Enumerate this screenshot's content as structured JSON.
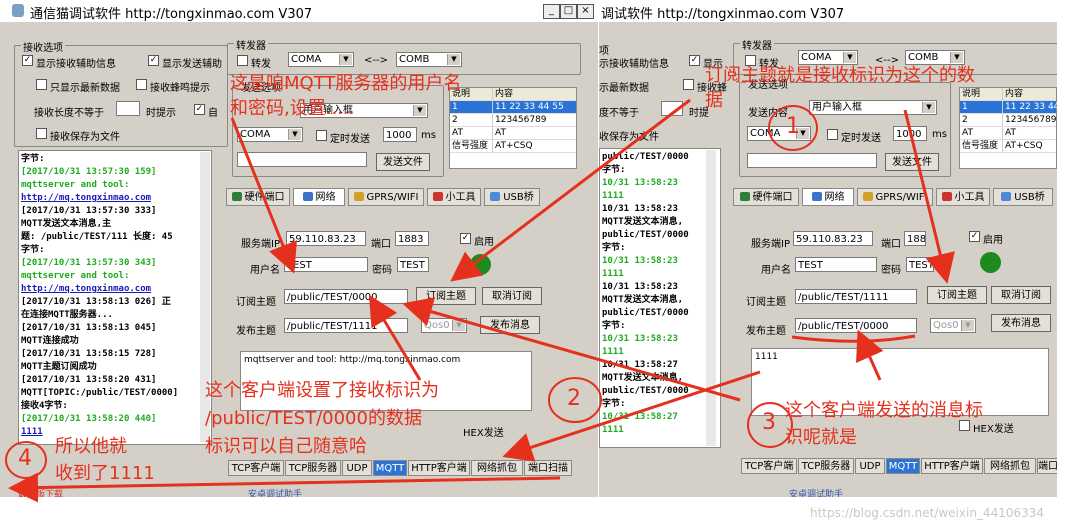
{
  "left": {
    "title": "通信猫调试软件 http://tongxinmao.com  V307",
    "win_buttons": [
      "_",
      "□",
      "×"
    ],
    "receive_group": "接收选项",
    "opt_show_recv_aux": "显示接收辅助信息",
    "opt_show_send_aux": "显示发送辅助",
    "opt_latest_only": "只显示最新数据",
    "opt_recv_beep": "接收蜂鸣提示",
    "len_label": "接收长度不等于",
    "len_suffix": "时提示",
    "opt_auto": "自",
    "opt_save_file": "接收保存为文件",
    "forward_group": "转发器",
    "forward_label": "转发",
    "com_a": "COMA",
    "arrow": "<-->",
    "com_b": "COMB",
    "send_group": "发送选项",
    "send_source": "用户输入框",
    "send_port": "COMA",
    "timed_send": "定时发送",
    "interval": "1000",
    "ms": "ms",
    "send_file_btn": "发送文件",
    "table_headers": [
      "说明",
      "内容"
    ],
    "table_rows": [
      [
        "1",
        "11 22 33 44 55"
      ],
      [
        "2",
        "123456789"
      ],
      [
        "AT",
        "AT"
      ],
      [
        "信号强度",
        "AT+CSQ"
      ]
    ],
    "tabs": [
      "硬件端口",
      "网络",
      "GPRS/WIFI",
      "小工具",
      "USB桥"
    ],
    "server_label": "服务端IP",
    "server_value": "59.110.83.23",
    "port_label": "端口",
    "port_value": "1883",
    "enable_label": "启用",
    "user_label": "用户名",
    "user_value": "TEST",
    "pwd_label": "密码",
    "pwd_value": "TEST",
    "sub_label": "订阅主题",
    "sub_value": "/public/TEST/0000",
    "sub_btn": "订阅主题",
    "unsub_btn": "取消订阅",
    "pub_label": "发布主题",
    "pub_value": "/public/TEST/1111",
    "qos": "Qos0",
    "pub_btn": "发布消息",
    "msg_text": "mqttserver and tool: http://mq.tongxinmao.com",
    "hex_send": "HEX发送",
    "bottom_tabs": [
      "TCP客户端",
      "TCP服务器",
      "UDP",
      "MQTT",
      "HTTP客户端",
      "网络抓包",
      "端口扫描"
    ],
    "status_left": "最新版下载",
    "status_mid": "安卓调试助手",
    "log_lines": [
      {
        "t": "字节:",
        "c": ""
      },
      {
        "t": "[2017/10/31 13:57:30 159]",
        "c": "green"
      },
      {
        "t": "mqttserver and tool:",
        "c": "green"
      },
      {
        "t": "http://mq.tongxinmao.com",
        "c": "blue"
      },
      {
        "t": "[2017/10/31 13:57:30 333]",
        "c": ""
      },
      {
        "t": "MQTT发送文本消息,主",
        "c": ""
      },
      {
        "t": "题: /public/TEST/111 长度: 45",
        "c": ""
      },
      {
        "t": "字节:",
        "c": ""
      },
      {
        "t": "[2017/10/31 13:57:30 343]",
        "c": "green"
      },
      {
        "t": "mqttserver and tool:",
        "c": "green"
      },
      {
        "t": "http://mq.tongxinmao.com",
        "c": "blue"
      },
      {
        "t": "[2017/10/31 13:58:13 026] 正",
        "c": ""
      },
      {
        "t": "在连接MQTT服务器...",
        "c": ""
      },
      {
        "t": "[2017/10/31 13:58:13 045]",
        "c": ""
      },
      {
        "t": "MQTT连接成功",
        "c": ""
      },
      {
        "t": "[2017/10/31 13:58:15 728]",
        "c": ""
      },
      {
        "t": "MQTT主题订阅成功",
        "c": ""
      },
      {
        "t": "[2017/10/31 13:58:20 431]",
        "c": ""
      },
      {
        "t": "MQTT[TOPIC:/public/TEST/0000]",
        "c": ""
      },
      {
        "t": "接收4字节:",
        "c": ""
      },
      {
        "t": "[2017/10/31 13:58:20 440]",
        "c": "green"
      },
      {
        "t": "1111",
        "c": "blue"
      }
    ]
  },
  "right": {
    "title": "调试软件 http://tongxinmao.com  V307",
    "partial_labels": [
      "项",
      "示接收辅助信息",
      "显示",
      "示最新数据",
      "接收蜂",
      "度不等于",
      "时提",
      "收保存为文件"
    ],
    "forward_group": "转发器",
    "forward_label": "转发",
    "com_a": "COMA",
    "arrow": "<-->",
    "com_b": "COMB",
    "send_group": "发送选项",
    "send_content": "发送内容",
    "send_source": "用户输入框",
    "send_port": "COMA",
    "timed_send": "定时发送",
    "interval": "1000",
    "ms": "ms",
    "send_file_btn": "发送文件",
    "table_headers": [
      "说明",
      "内容"
    ],
    "table_rows": [
      [
        "1",
        "11 22 33 44 5"
      ],
      [
        "2",
        "123456789"
      ],
      [
        "AT",
        "AT"
      ],
      [
        "信号强度",
        "AT+CSQ"
      ]
    ],
    "tabs": [
      "硬件端口",
      "网络",
      "GPRS/WIFI",
      "小工具",
      "USB桥"
    ],
    "server_label": "服务端IP",
    "server_value": "59.110.83.23",
    "port_label": "端口",
    "port_value": "188",
    "enable_label": "启用",
    "user_label": "用户名",
    "user_value": "TEST",
    "pwd_label": "密码",
    "pwd_value": "TEST",
    "sub_label": "订阅主题",
    "sub_value": "/public/TEST/1111",
    "sub_btn": "订阅主题",
    "unsub_btn": "取消订阅",
    "pub_label": "发布主题",
    "pub_value": "/public/TEST/0000",
    "qos": "Qos0",
    "pub_btn": "发布消息",
    "msg_text": "1111",
    "hex_send": "HEX发送",
    "bottom_tabs": [
      "TCP客户端",
      "TCP服务器",
      "UDP",
      "MQTT",
      "HTTP客户端",
      "网络抓包",
      "端口"
    ],
    "status_mid": "安卓调试助手",
    "log_lines": [
      {
        "t": "public/TEST/0000",
        "c": ""
      },
      {
        "t": "字节:",
        "c": ""
      },
      {
        "t": "10/31 13:58:23",
        "c": "green"
      },
      {
        "t": "1111",
        "c": "green"
      },
      {
        "t": "10/31 13:58:23",
        "c": ""
      },
      {
        "t": "MQTT发送文本消息,",
        "c": ""
      },
      {
        "t": "public/TEST/0000",
        "c": ""
      },
      {
        "t": "字节:",
        "c": ""
      },
      {
        "t": "10/31 13:58:23",
        "c": "green"
      },
      {
        "t": "1111",
        "c": "green"
      },
      {
        "t": "10/31 13:58:23",
        "c": ""
      },
      {
        "t": "MQTT发送文本消息,",
        "c": ""
      },
      {
        "t": "public/TEST/0000",
        "c": ""
      },
      {
        "t": "字节:",
        "c": ""
      },
      {
        "t": "10/31 13:58:23",
        "c": "green"
      },
      {
        "t": "1111",
        "c": "green"
      },
      {
        "t": "10/31 13:58:27",
        "c": ""
      },
      {
        "t": "MQTT发送文本消息,",
        "c": ""
      },
      {
        "t": "public/TEST/0000",
        "c": ""
      },
      {
        "t": "字节:",
        "c": ""
      },
      {
        "t": "10/31 13:58:27",
        "c": "green"
      },
      {
        "t": "1111",
        "c": "green"
      }
    ]
  },
  "annotations": {
    "a1_line1": "这是咱MQTT服务器的用户名",
    "a1_line2": "和密码,设置.....",
    "a2_line1": "订阅主题就是接收标识为这个的数",
    "a2_line2": "据",
    "a3_line1": "这个客户端设置了接收标识为",
    "a3_line2": "/public/TEST/0000的数据",
    "a3_line3": "标识可以自己随意哈",
    "a4_line1": "所以他就",
    "a4_line2": "收到了1111",
    "a5_line1": "这个客户端发送的消息标",
    "a5_line2": "识呢就是",
    "circle1": "1",
    "circle2": "2",
    "circle3": "3",
    "circle4": "4"
  },
  "watermark": "https://blog.csdn.net/weixin_44106334",
  "colors": {
    "annotation": "#e5301d",
    "window_bg": "#d4d0c8",
    "green": "#1faa1f",
    "blue": "#1a1ab8",
    "tab_active": "#2b74d6"
  }
}
